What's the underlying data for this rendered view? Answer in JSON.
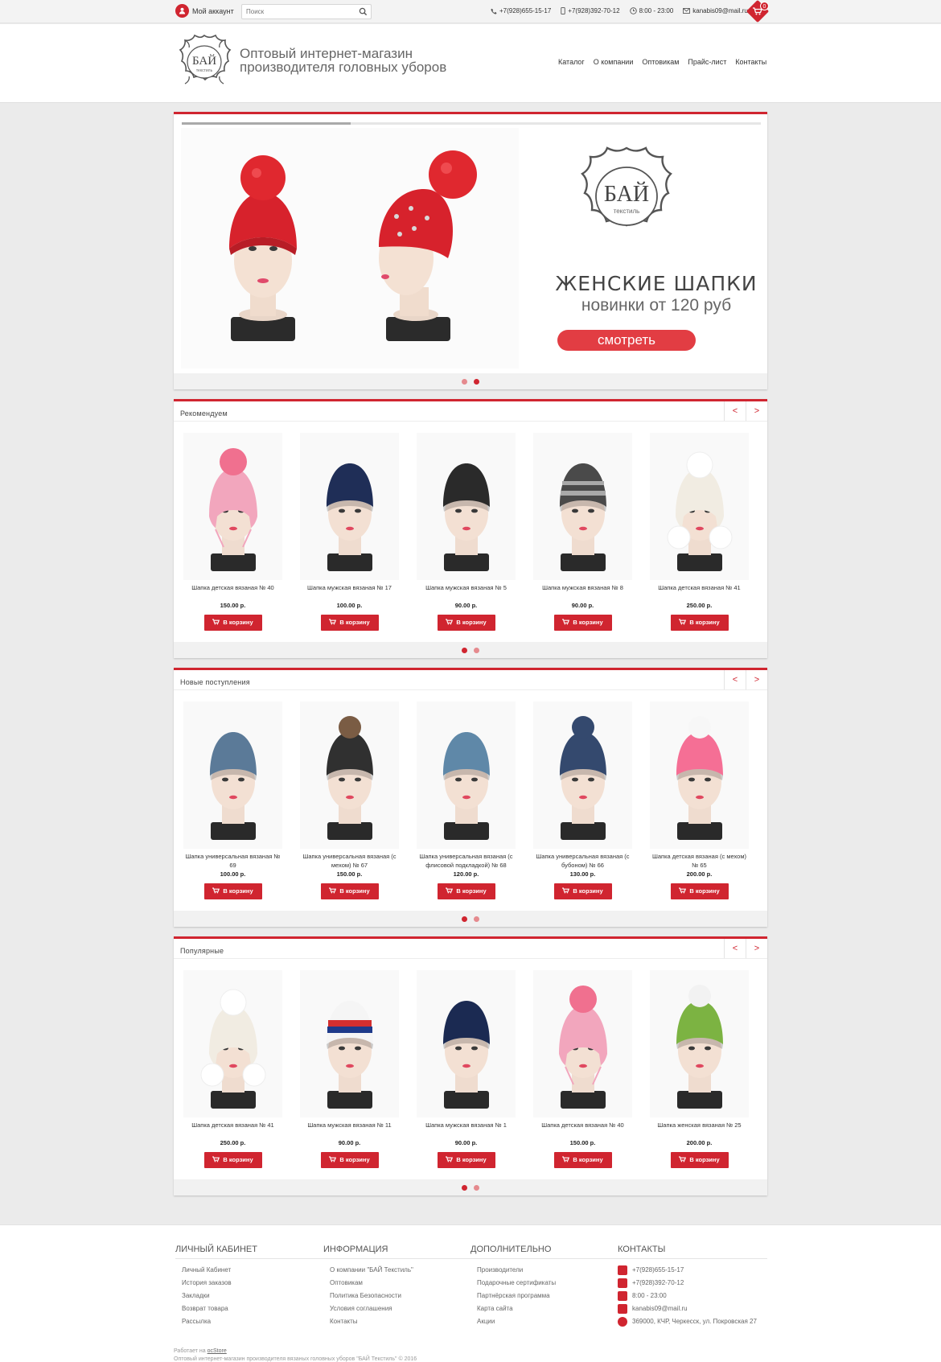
{
  "topbar": {
    "account_label": "Мой аккаунт",
    "search_placeholder": "Поиск",
    "phone1": "+7(928)655-15-17",
    "phone2": "+7(928)392-70-12",
    "hours": "8:00 - 23:00",
    "email": "kanabis09@mail.ru",
    "cart_count": "0"
  },
  "header": {
    "logo_text": "БАЙ",
    "logo_sub": "текстиль",
    "slogan_line1": "Оптовый интернет-магазин",
    "slogan_line2": "производителя головных уборов",
    "nav": [
      "Каталог",
      "О компании",
      "Оптовикам",
      "Прайс-лист",
      "Контакты"
    ]
  },
  "hero": {
    "logo_text": "БАЙ",
    "logo_sub": "текстиль",
    "title": "ЖЕНСКИЕ ШАПКИ",
    "subtitle": "новинки от 120 руб",
    "button": "смотреть"
  },
  "buy_label": "В корзину",
  "sections": [
    {
      "title": "Рекомендуем",
      "products": [
        {
          "name": "Шапка детская вязаная № 40",
          "price": "150.00 р.",
          "hat": "#f2a6bd",
          "pompom": "#f0708f",
          "style": "kidpink"
        },
        {
          "name": "Шапка мужская вязаная № 17",
          "price": "100.00 р.",
          "hat": "#1f2e57",
          "pompom": "",
          "style": "plain"
        },
        {
          "name": "Шапка мужская вязаная № 5",
          "price": "90.00 р.",
          "hat": "#2a2a2a",
          "pompom": "",
          "style": "plain"
        },
        {
          "name": "Шапка мужская вязаная № 8",
          "price": "90.00 р.",
          "hat": "#4a4a4a",
          "pompom": "",
          "style": "stripe"
        },
        {
          "name": "Шапка детская вязаная № 41",
          "price": "250.00 р.",
          "hat": "#f1ece2",
          "pompom": "#ffffff",
          "style": "kidwhite"
        }
      ]
    },
    {
      "title": "Новые поступления",
      "products": [
        {
          "name": "Шапка универсальная вязаная № 69",
          "price": "100.00 р.",
          "hat": "#5b7a98",
          "pompom": "",
          "style": "plain"
        },
        {
          "name": "Шапка универсальная вязаная (с мехом) № 67",
          "price": "150.00 р.",
          "hat": "#303030",
          "pompom": "#7a5c44",
          "style": "pom"
        },
        {
          "name": "Шапка универсальная вязаная (с флисовой подкладкой) № 68",
          "price": "120.00 р.",
          "hat": "#5f88a8",
          "pompom": "",
          "style": "plain"
        },
        {
          "name": "Шапка универсальная вязаная (с бубоном) № 66",
          "price": "130.00 р.",
          "hat": "#34496e",
          "pompom": "#34496e",
          "style": "pom"
        },
        {
          "name": "Шапка детская вязаная (с мехом) № 65",
          "price": "200.00 р.",
          "hat": "#f56f95",
          "pompom": "#f7f7f7",
          "style": "pom"
        }
      ]
    },
    {
      "title": "Популярные",
      "products": [
        {
          "name": "Шапка детская вязаная № 41",
          "price": "250.00 р.",
          "hat": "#f1ece2",
          "pompom": "#ffffff",
          "style": "kidwhite"
        },
        {
          "name": "Шапка мужская вязаная № 11",
          "price": "90.00 р.",
          "hat": "#f5f5f5",
          "pompom": "",
          "style": "tricolor"
        },
        {
          "name": "Шапка мужская вязаная № 1",
          "price": "90.00 р.",
          "hat": "#1b2a52",
          "pompom": "",
          "style": "plain"
        },
        {
          "name": "Шапка детская вязаная № 40",
          "price": "150.00 р.",
          "hat": "#f2a6bd",
          "pompom": "#f0708f",
          "style": "kidpink"
        },
        {
          "name": "Шапка женская вязаная № 25",
          "price": "200.00 р.",
          "hat": "#7cb342",
          "pompom": "#f2f2f2",
          "style": "pom"
        }
      ]
    }
  ],
  "footer": {
    "cols": [
      {
        "title": "ЛИЧНЫЙ КАБИНЕТ",
        "items": [
          "Личный Кабинет",
          "История заказов",
          "Закладки",
          "Возврат товара",
          "Рассылка"
        ]
      },
      {
        "title": "ИНФОРМАЦИЯ",
        "items": [
          "О компании \"БАЙ Текстиль\"",
          "Оптовикам",
          "Политика Безопасности",
          "Условия соглашения",
          "Контакты"
        ]
      },
      {
        "title": "ДОПОЛНИТЕЛЬНО",
        "items": [
          "Производители",
          "Подарочные сертификаты",
          "Партнёрская программа",
          "Карта сайта",
          "Акции"
        ]
      }
    ],
    "contacts_title": "КОНТАКТЫ",
    "contacts": [
      "+7(928)655-15-17",
      "+7(928)392-70-12",
      "8:00 - 23:00",
      "kanabis09@mail.ru",
      "369000, КЧР, Черкесск, ул. Покровская 27"
    ],
    "powered_prefix": "Работает на",
    "powered_link": "ocStore",
    "copyright": "Оптовый интернет-магазин производителя вязаных головных уборов \"БАЙ Текстиль\" © 2016"
  },
  "colors": {
    "accent": "#d02530",
    "background": "#ebebeb"
  }
}
